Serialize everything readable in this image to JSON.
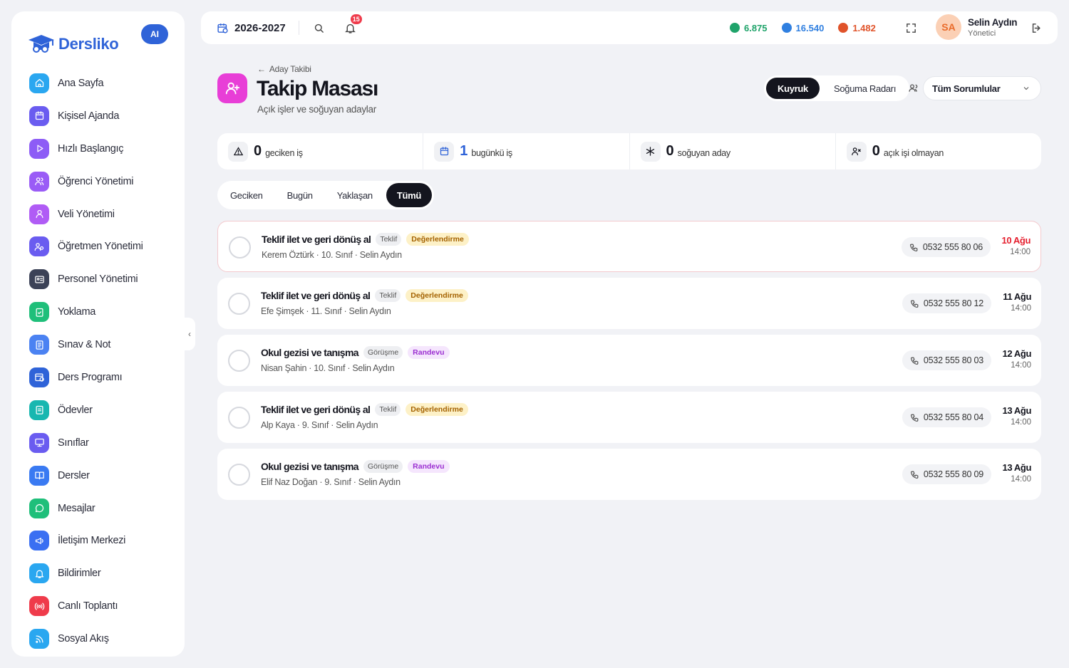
{
  "brand": {
    "name": "Dersliko",
    "ai_label": "AI",
    "color": "#2f63d8"
  },
  "sidebar": {
    "items": [
      {
        "label": "Ana Sayfa",
        "icon": "home-icon",
        "color": "#2aa7f0"
      },
      {
        "label": "Kişisel Ajanda",
        "icon": "calendar-icon",
        "color": "#6a5cf0"
      },
      {
        "label": "Hızlı Başlangıç",
        "icon": "play-icon",
        "color": "#8d5cf6"
      },
      {
        "label": "Öğrenci Yönetimi",
        "icon": "users-icon",
        "color": "#9a5cf6"
      },
      {
        "label": "Veli Yönetimi",
        "icon": "parent-icon",
        "color": "#b05cf5"
      },
      {
        "label": "Öğretmen Yönetimi",
        "icon": "teacher-icon",
        "color": "#6a5cf0"
      },
      {
        "label": "Personel Yönetimi",
        "icon": "id-card-icon",
        "color": "#3c4257"
      },
      {
        "label": "Yoklama",
        "icon": "clipboard-check-icon",
        "color": "#1fbf7a"
      },
      {
        "label": "Sınav & Not",
        "icon": "file-icon",
        "color": "#4b82f2"
      },
      {
        "label": "Ders Programı",
        "icon": "schedule-icon",
        "color": "#2f63d8"
      },
      {
        "label": "Ödevler",
        "icon": "homework-icon",
        "color": "#18b7b0"
      },
      {
        "label": "Sınıflar",
        "icon": "classroom-icon",
        "color": "#6a5cf0"
      },
      {
        "label": "Dersler",
        "icon": "book-icon",
        "color": "#3a7af2"
      },
      {
        "label": "Mesajlar",
        "icon": "message-icon",
        "color": "#1fbf7a"
      },
      {
        "label": "İletişim Merkezi",
        "icon": "megaphone-icon",
        "color": "#3a6ff2"
      },
      {
        "label": "Bildirimler",
        "icon": "bell-icon",
        "color": "#2aa7f0"
      },
      {
        "label": "Canlı Toplantı",
        "icon": "broadcast-icon",
        "color": "#ef3b4b"
      },
      {
        "label": "Sosyal Akış",
        "icon": "rss-icon",
        "color": "#2aa7f0"
      }
    ]
  },
  "topbar": {
    "year": "2026-2027",
    "notification_count": "15",
    "stats": [
      {
        "value": "6.875",
        "color": "#1fa36a",
        "icon": "gem-green-icon"
      },
      {
        "value": "16.540",
        "color": "#2f7fe0",
        "icon": "gem-blue-icon"
      },
      {
        "value": "1.482",
        "color": "#e0532a",
        "icon": "fire-icon"
      }
    ],
    "user": {
      "initials": "SA",
      "name": "Selin Aydın",
      "role": "Yönetici"
    }
  },
  "page": {
    "breadcrumb": "Aday Takibi",
    "title": "Takip Masası",
    "subtitle": "Açık işler ve soğuyan adaylar",
    "view_toggle": [
      "Kuyruk",
      "Soğuma Radarı"
    ],
    "responsible_select": "Tüm Sorumlular"
  },
  "summary": [
    {
      "value": "0",
      "label": "geciken iş",
      "icon": "warning-icon",
      "color": "#14151e"
    },
    {
      "value": "1",
      "label": "bugünkü iş",
      "icon": "calendar-icon",
      "color": "#2f63d8"
    },
    {
      "value": "0",
      "label": "soğuyan aday",
      "icon": "snowflake-icon",
      "color": "#14151e"
    },
    {
      "value": "0",
      "label": "açık işi olmayan",
      "icon": "user-x-icon",
      "color": "#14151e"
    }
  ],
  "filter_tabs": [
    "Geciken",
    "Bugün",
    "Yaklaşan",
    "Tümü"
  ],
  "tasks": [
    {
      "title": "Teklif ilet ve geri dönüş al",
      "type": "Teklif",
      "stage": "Değerlendirme",
      "stage_bg": "#fdf1c7",
      "stage_fg": "#a46200",
      "meta": "Kerem Öztürk · 10. Sınıf · Selin Aydın",
      "phone": "0532 555 80 06",
      "date": "10 Ağu",
      "time": "14:00",
      "overdue": true
    },
    {
      "title": "Teklif ilet ve geri dönüş al",
      "type": "Teklif",
      "stage": "Değerlendirme",
      "stage_bg": "#fdf1c7",
      "stage_fg": "#a46200",
      "meta": "Efe Şimşek · 11. Sınıf · Selin Aydın",
      "phone": "0532 555 80 12",
      "date": "11 Ağu",
      "time": "14:00",
      "overdue": false
    },
    {
      "title": "Okul gezisi ve tanışma",
      "type": "Görüşme",
      "stage": "Randevu",
      "stage_bg": "#f5e6fd",
      "stage_fg": "#9b2fd1",
      "meta": "Nisan Şahin · 10. Sınıf · Selin Aydın",
      "phone": "0532 555 80 03",
      "date": "12 Ağu",
      "time": "14:00",
      "overdue": false
    },
    {
      "title": "Teklif ilet ve geri dönüş al",
      "type": "Teklif",
      "stage": "Değerlendirme",
      "stage_bg": "#fdf1c7",
      "stage_fg": "#a46200",
      "meta": "Alp Kaya · 9. Sınıf · Selin Aydın",
      "phone": "0532 555 80 04",
      "date": "13 Ağu",
      "time": "14:00",
      "overdue": false
    },
    {
      "title": "Okul gezisi ve tanışma",
      "type": "Görüşme",
      "stage": "Randevu",
      "stage_bg": "#f5e6fd",
      "stage_fg": "#9b2fd1",
      "meta": "Elif Naz Doğan · 9. Sınıf · Selin Aydın",
      "phone": "0532 555 80 09",
      "date": "13 Ağu",
      "time": "14:00",
      "overdue": false
    }
  ]
}
